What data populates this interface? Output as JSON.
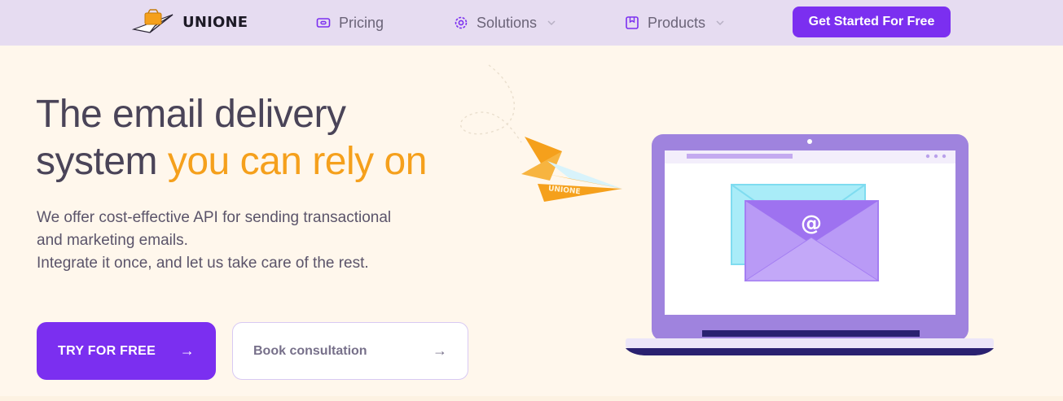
{
  "nav": {
    "logo_text": "UNIONE",
    "items": [
      {
        "label": "Pricing",
        "icon": "wallet-icon",
        "has_dropdown": false
      },
      {
        "label": "Solutions",
        "icon": "gear-icon",
        "has_dropdown": true
      },
      {
        "label": "Products",
        "icon": "box-icon",
        "has_dropdown": true
      }
    ],
    "cta_label": "Get Started For Free"
  },
  "hero": {
    "headline_line1": "The email delivery",
    "headline_line2_plain": "system ",
    "headline_line2_accent": "you can rely on",
    "subtitle_line1": "We offer cost-effective API for sending transactional",
    "subtitle_line2": "and marketing emails.",
    "subtitle_line3": "Integrate it once, and let us take care of the rest.",
    "primary_button": "TRY FOR FREE",
    "secondary_button": "Book consultation",
    "arrow": "→"
  },
  "illustration": {
    "plane_label": "UNIONE",
    "envelope_symbol": "@"
  },
  "colors": {
    "brand_purple": "#7b2ff0",
    "accent_orange": "#f5a01c",
    "nav_bg": "#e6dcf1",
    "page_bg": "#fff7ec"
  }
}
